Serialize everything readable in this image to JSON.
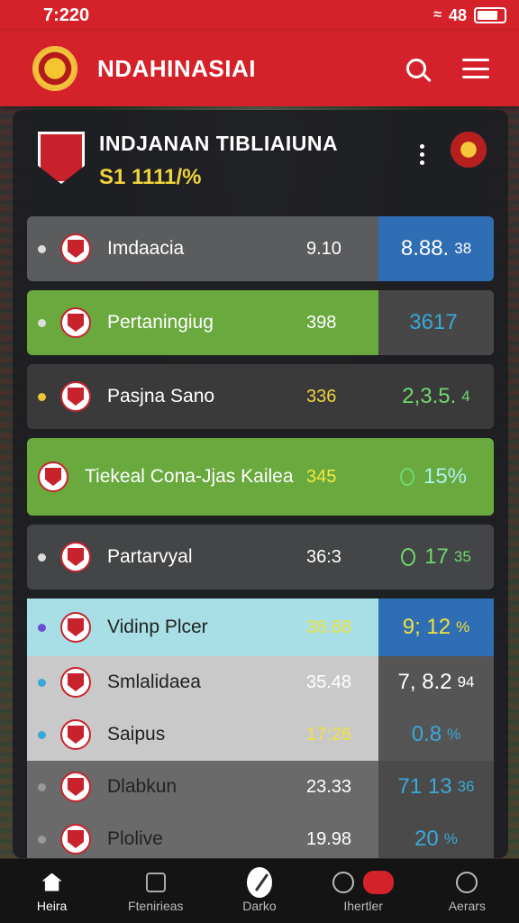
{
  "status": {
    "time": "7:220",
    "signal": "48"
  },
  "appbar": {
    "title": "NDAHINASIAI"
  },
  "league": {
    "name": "INDJANAN TIBLIAIUNA",
    "subtitle": "S1 1111/%"
  },
  "rows": [
    {
      "name": "Imdaacia",
      "mid": "9.10",
      "value": "8.88.",
      "small": "38",
      "bg": "#5a5c5e",
      "valbg": "#2f6db4",
      "dot": "#ddd",
      "valcolor": "#ffffff",
      "midcolor": "#ffffff"
    },
    {
      "name": "Pertaningiug",
      "mid": "398",
      "value": "3617",
      "small": "",
      "bg": "#69a93e",
      "valbg": "#474747",
      "dot": "#ddd",
      "valcolor": "#3aa8d8",
      "midcolor": "#ffffff"
    },
    {
      "name": "Pasjna Sano",
      "mid": "336",
      "value": "2,3.5.",
      "small": "4",
      "bg": "#3b3a3a",
      "valbg": "#3b3a3a",
      "dot": "#f0c33a",
      "valcolor": "#6fd86f",
      "midcolor": "#f0d23c"
    },
    {
      "name": "Tiekeal Cona-Jjas Kailea",
      "mid": "345",
      "value": "15%",
      "small": "",
      "bg": "#69a93e",
      "valbg": "#69a93e",
      "dot": "",
      "valcolor": "#aef0f0",
      "midcolor": "#f7e83c"
    },
    {
      "name": "Partarvyal",
      "mid": "36:3",
      "value": "17",
      "small": "35",
      "bg": "#434546",
      "valbg": "#434546",
      "dot": "#ddd",
      "valcolor": "#6fd86f",
      "midcolor": "#ffffff"
    },
    {
      "name": "Vidinp Plcer",
      "mid": "38.68",
      "value": "9; 12",
      "small": "%",
      "bg": "#a8dfe6",
      "valbg": "#2f6db4",
      "dot": "#6b4fd0",
      "valcolor": "#f0e23c",
      "midcolor": "#f0e23c",
      "namecolor": "#222"
    },
    {
      "name": "Smlalidaea",
      "mid": "35.48",
      "value": "7, 8.2",
      "small": "94",
      "bg": "#c9c9c9",
      "valbg": "#555555",
      "dot": "#3aa8d8",
      "valcolor": "#ffffff",
      "midcolor": "#ffffff",
      "namecolor": "#222"
    },
    {
      "name": "Saipus",
      "mid": "17:26",
      "value": "0.8",
      "small": "%",
      "bg": "#c9c9c9",
      "valbg": "#555555",
      "dot": "#3aa8d8",
      "valcolor": "#3aa8d8",
      "midcolor": "#f0e23c",
      "namecolor": "#222"
    },
    {
      "name": "Dlabkun",
      "mid": "23.33",
      "value": "71 13",
      "small": "36",
      "bg": "#6a6a6a",
      "valbg": "#4a4a4a",
      "dot": "#999",
      "valcolor": "#3aa8d8",
      "midcolor": "#ffffff",
      "namecolor": "#222"
    },
    {
      "name": "Plolive",
      "mid": "19.98",
      "value": "20",
      "small": "%",
      "bg": "#6a6a6a",
      "valbg": "#4a4a4a",
      "dot": "#999",
      "valcolor": "#3aa8d8",
      "midcolor": "#ffffff",
      "namecolor": "#222"
    }
  ],
  "nav": [
    {
      "label": "Heira",
      "icon": "home-icon"
    },
    {
      "label": "Ftenirieas",
      "icon": "box-icon"
    },
    {
      "label": "Darko",
      "icon": "disc-icon"
    },
    {
      "label": "Ihertler",
      "icon": "target-icon"
    },
    {
      "label": "Aerars",
      "icon": "search-icon"
    }
  ]
}
